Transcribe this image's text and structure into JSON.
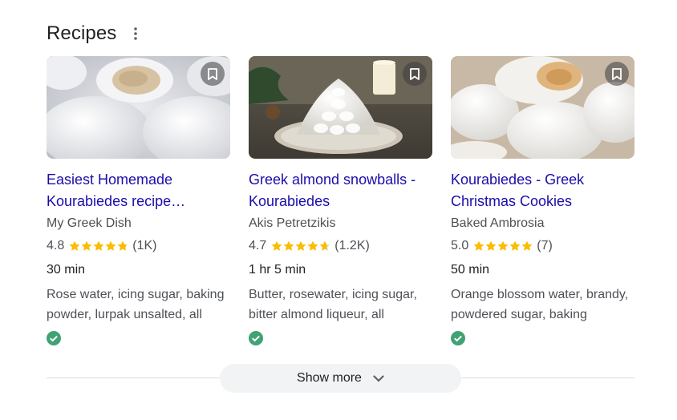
{
  "section": {
    "title": "Recipes",
    "more_icon": "more-vert-icon"
  },
  "cards": [
    {
      "title": "Easiest Homemade Kourabiedes recipe…",
      "source": "My Greek Dish",
      "rating": "4.8",
      "rating_value": 4.8,
      "reviews": "(1K)",
      "time": "30 min",
      "ingredients": "Rose water, icing sugar, baking powder, lurpak unsalted, all",
      "image_icon": "kourabiedes-photo",
      "bookmark_icon": "bookmark-icon",
      "verified_icon": "check-circle-icon"
    },
    {
      "title": "Greek almond snowballs - Kourabiedes",
      "source": "Akis Petretzikis",
      "rating": "4.7",
      "rating_value": 4.7,
      "reviews": "(1.2K)",
      "time": "1 hr 5 min",
      "ingredients": "Butter, rosewater, icing sugar, bitter almond liqueur, all",
      "image_icon": "almond-snowballs-photo",
      "bookmark_icon": "bookmark-icon",
      "verified_icon": "check-circle-icon"
    },
    {
      "title": "Kourabiedes - Greek Christmas Cookies",
      "source": "Baked Ambrosia",
      "rating": "5.0",
      "rating_value": 5.0,
      "reviews": "(7)",
      "time": "50 min",
      "ingredients": "Orange blossom water, brandy, powdered sugar, baking",
      "image_icon": "christmas-cookies-photo",
      "bookmark_icon": "bookmark-icon",
      "verified_icon": "check-circle-icon"
    }
  ],
  "show_more": {
    "label": "Show more",
    "icon": "chevron-down-icon"
  },
  "colors": {
    "link": "#1a0dab",
    "star": "#fbbc04",
    "check": "#34a853",
    "button_bg": "#f1f3f4"
  }
}
